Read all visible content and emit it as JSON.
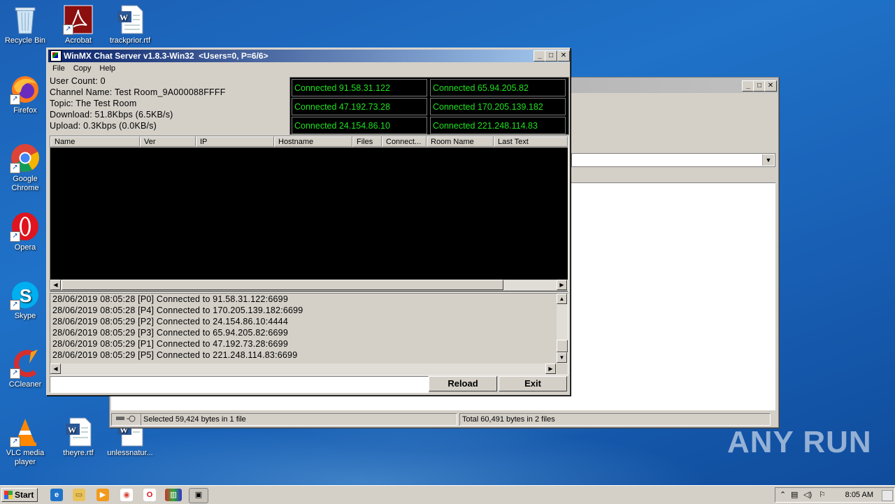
{
  "desktop": {
    "icons": [
      {
        "label": "Recycle Bin",
        "icon": "recycle-bin-icon"
      },
      {
        "label": "Acrobat",
        "icon": "acrobat-icon"
      },
      {
        "label": "trackprior.rtf",
        "icon": "word-document-icon"
      },
      {
        "label": "Firefox",
        "icon": "firefox-icon"
      },
      {
        "label": "Google Chrome",
        "icon": "chrome-icon"
      },
      {
        "label": "Opera",
        "icon": "opera-icon"
      },
      {
        "label": "Skype",
        "icon": "skype-icon"
      },
      {
        "label": "CCleaner",
        "icon": "ccleaner-icon"
      },
      {
        "label": "VLC media player",
        "icon": "vlc-icon"
      },
      {
        "label": "theyre.rtf",
        "icon": "word-document-icon"
      },
      {
        "label": "unlessnatur...",
        "icon": "word-document-icon"
      }
    ],
    "watermark": "ANY RUN"
  },
  "back_window": {
    "status_selected": "Selected 59,424 bytes in 1 file",
    "status_total": "Total 60,491 bytes in 2 files"
  },
  "winmx": {
    "title": "WinMX Chat Server v1.8.3-Win32  <Users=0, P=6/6>",
    "menu": [
      "File",
      "Copy",
      "Help"
    ],
    "info": {
      "user_count": "User Count: 0",
      "channel_name": "Channel Name: Test Room_9A000088FFFF",
      "topic": "Topic: The Test Room",
      "download": "Download: 51.8Kbps (6.5KB/s)",
      "upload": "Upload: 0.3Kbps (0.0KB/s)"
    },
    "connections": [
      "Connected 91.58.31.122",
      "Connected 65.94.205.82",
      "Connected 47.192.73.28",
      "Connected 170.205.139.182",
      "Connected 24.154.86.10",
      "Connected 221.248.114.83"
    ],
    "columns": [
      "Name",
      "Ver",
      "IP",
      "Hostname",
      "Files",
      "Connect...",
      "Room Name",
      "Last Text"
    ],
    "log": [
      "28/06/2019 08:05:28 [P0] Connected to 91.58.31.122:6699",
      "28/06/2019 08:05:28 [P4] Connected to 170.205.139.182:6699",
      "28/06/2019 08:05:29 [P2] Connected to 24.154.86.10:4444",
      "28/06/2019 08:05:29 [P3] Connected to 65.94.205.82:6699",
      "28/06/2019 08:05:29 [P1] Connected to 47.192.73.28:6699",
      "28/06/2019 08:05:29 [P5] Connected to 221.248.114.83:6699"
    ],
    "input_value": "",
    "reload_label": "Reload",
    "exit_label": "Exit",
    "colors": {
      "connected_text": "#1fe01f",
      "title_start": "#0a246a",
      "title_end": "#a6caf0"
    }
  },
  "taskbar": {
    "start_label": "Start",
    "clock": "8:05 AM"
  }
}
